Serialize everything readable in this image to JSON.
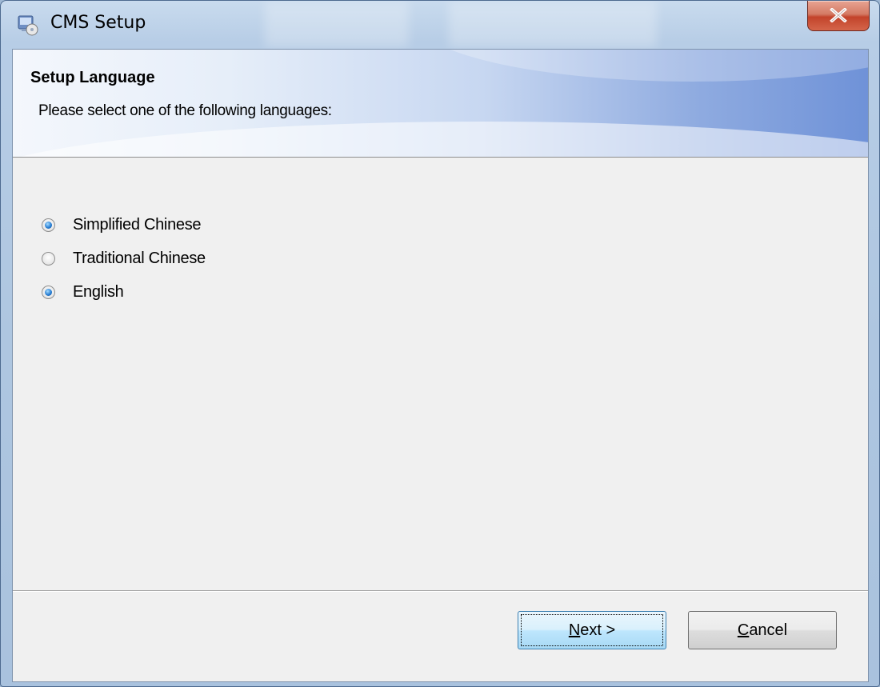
{
  "window": {
    "title": "CMS Setup"
  },
  "header": {
    "title": "Setup Language",
    "subtitle": "Please select one of the following languages:"
  },
  "languages": [
    {
      "label": "Simplified Chinese",
      "checked": true
    },
    {
      "label": "Traditional Chinese",
      "checked": false
    },
    {
      "label": "English",
      "checked": true
    }
  ],
  "buttons": {
    "next_access_key": "N",
    "next_rest": "ext >",
    "cancel_access_key": "C",
    "cancel_rest": "ancel"
  },
  "icons": {
    "title": "setup-app-icon",
    "close": "close-icon"
  },
  "colors": {
    "close_button": "#c3432b",
    "default_button_border": "#3c7fb1",
    "radio_dot": "#2a7fd3"
  }
}
